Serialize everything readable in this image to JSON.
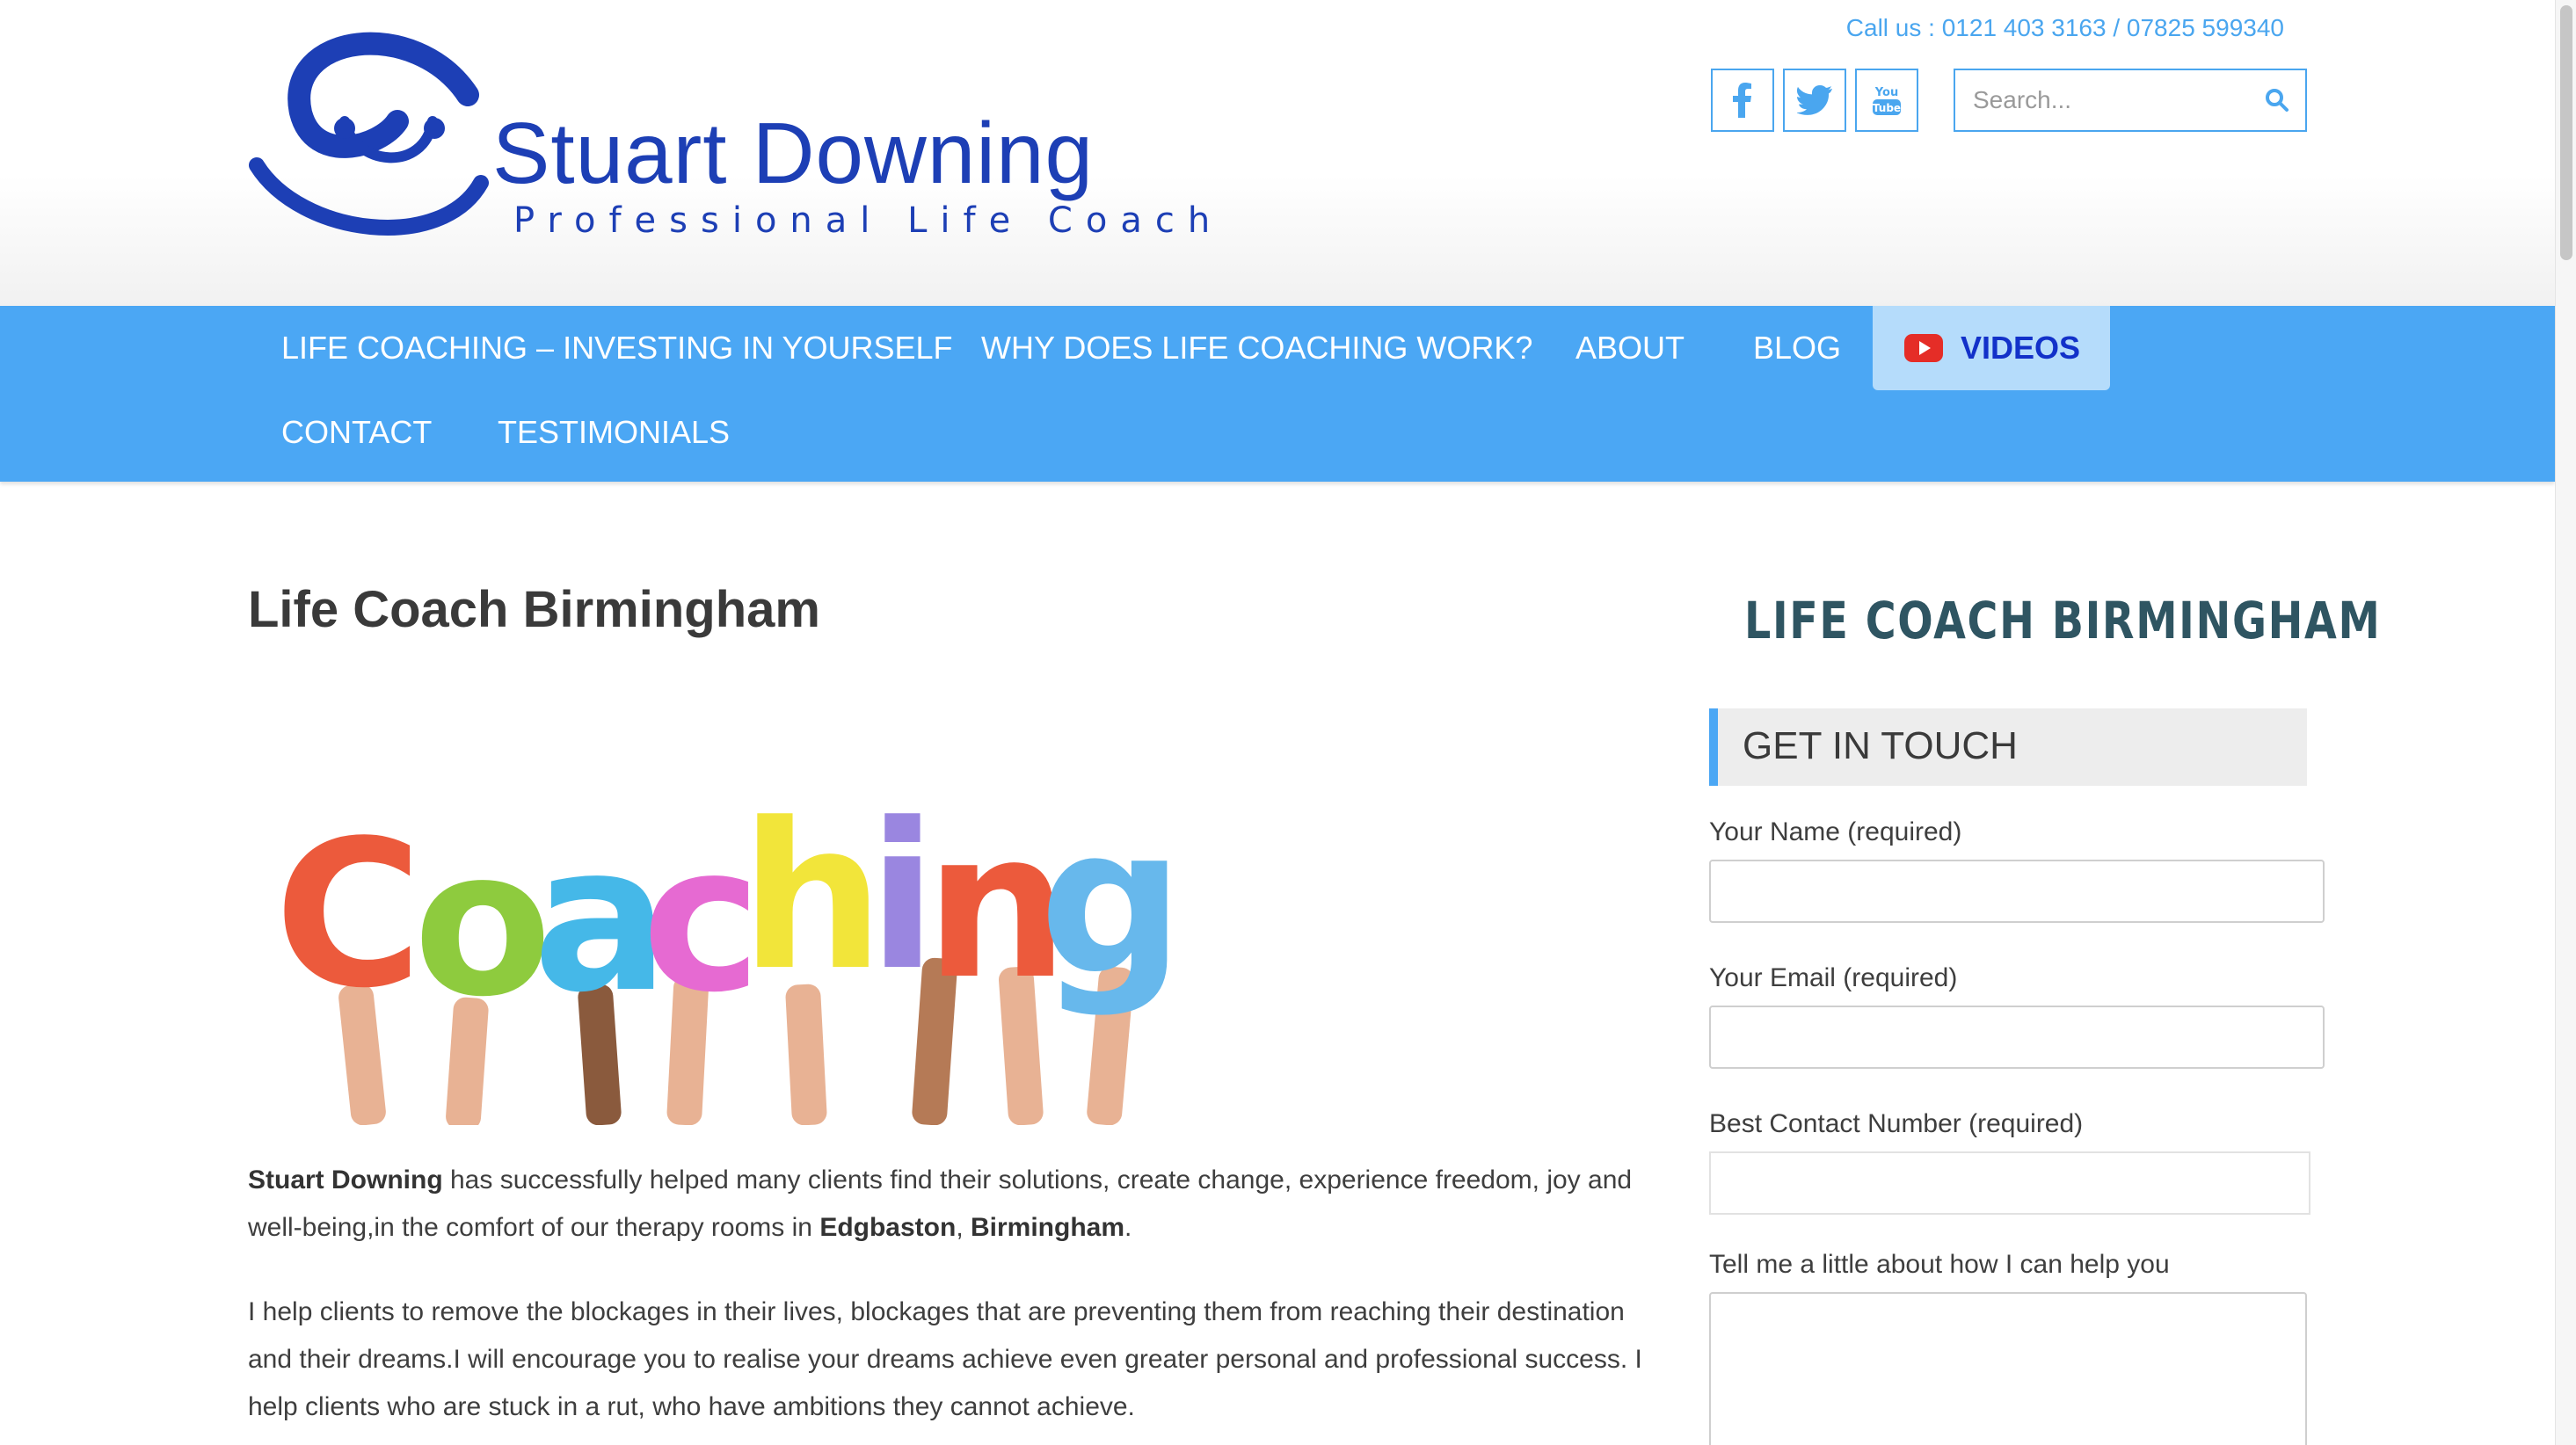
{
  "header": {
    "logo_name": "Stuart Downing",
    "logo_tagline": "Professional Life Coach",
    "call_us": "Call us : 0121 403 3163 / 07825 599340",
    "social": [
      {
        "name": "facebook-icon"
      },
      {
        "name": "twitter-icon"
      },
      {
        "name": "youtube-icon"
      }
    ],
    "search_placeholder": "Search...",
    "colors": {
      "accent": "#4ba7f4",
      "brand": "#1d3fb5"
    }
  },
  "nav": {
    "items": [
      {
        "label": "LIFE COACHING – INVESTING IN YOURSELF"
      },
      {
        "label": "WHY DOES LIFE COACHING WORK?"
      },
      {
        "label": "ABOUT"
      },
      {
        "label": "BLOG"
      },
      {
        "label": "VIDEOS"
      },
      {
        "label": "CONTACT"
      },
      {
        "label": "TESTIMONIALS"
      }
    ]
  },
  "main": {
    "title": "Life Coach Birmingham",
    "hero_letters": [
      "C",
      "o",
      "a",
      "c",
      "h",
      "i",
      "n",
      "g"
    ],
    "p1": {
      "s1": "Stuart Downing",
      "t1": " has successfully helped many clients find their solutions, create change, experience freedom, joy and well-being,in the comfort of our therapy rooms in ",
      "s2": "Edgbaston",
      "t2": ", ",
      "s3": "Birmingham",
      "t3": "."
    },
    "p2": "I help clients to remove the blockages in their lives, blockages that are preventing them from reaching their destination and their dreams.I will encourage you to realise your dreams achieve even greater personal and professional success. I help clients who are stuck in a rut, who have ambitions they cannot achieve."
  },
  "sidebar": {
    "banner": "LIFE COACH BIRMINGHAM",
    "widget_title": "GET IN TOUCH",
    "form": {
      "name_label": "Your Name (required)",
      "email_label": "Your Email (required)",
      "phone_label": "Best Contact Number (required)",
      "message_label": "Tell me a little about how I can help you"
    }
  }
}
